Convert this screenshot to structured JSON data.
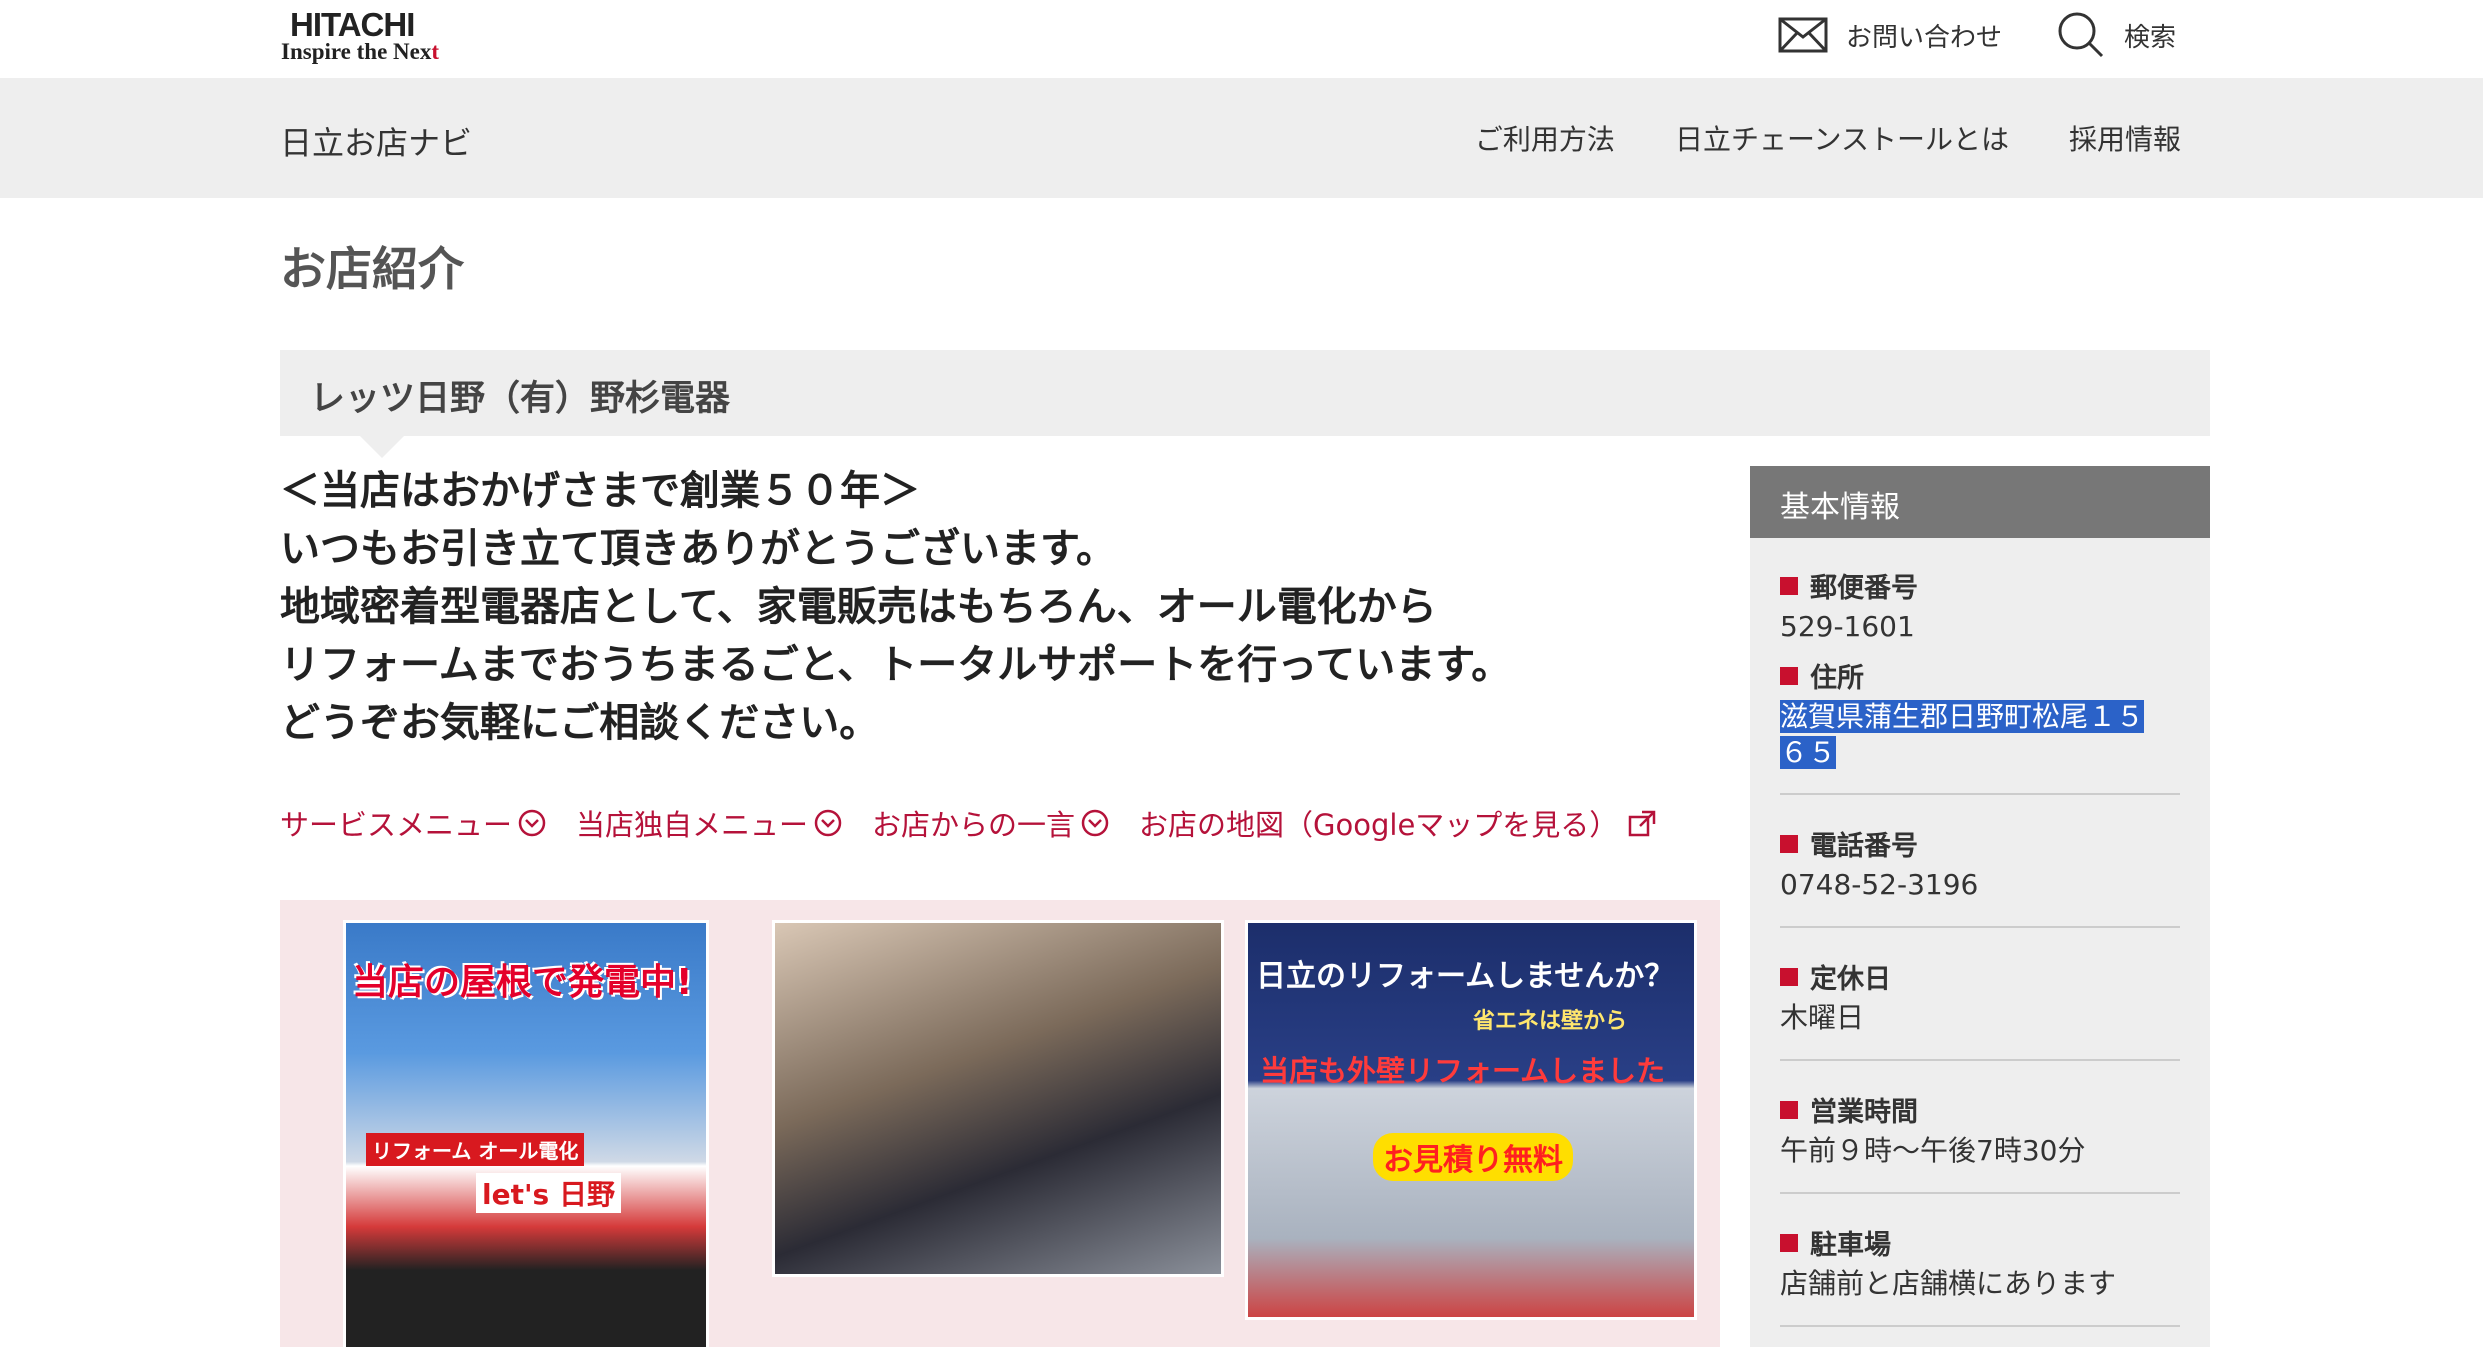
{
  "header": {
    "logo_text": "HITACHI",
    "tagline_main": "Inspire the Nex",
    "tagline_end": "t",
    "contact_label": "お問い合わせ",
    "search_label": "検索"
  },
  "nav": {
    "site_name": "日立お店ナビ",
    "links": [
      "ご利用方法",
      "日立チェーンストールとは",
      "採用情報"
    ]
  },
  "page": {
    "title": "お店紹介",
    "shop_name": "レッツ日野（有）野杉電器"
  },
  "intro": {
    "lines": [
      "＜当店はおかげさまで創業５０年＞",
      "いつもお引き立て頂きありがとうございます。",
      "地域密着型電器店として、家電販売はもちろん、オール電化から",
      "リフォームまでおうちまるごと、トータルサポートを行っています。",
      "どうぞお気軽にご相談ください。"
    ]
  },
  "anchors": [
    "サービスメニュー",
    "当店独自メニュー",
    "お店からの一言",
    "お店の地図（Googleマップを見る）"
  ],
  "photos": {
    "p1": [
      "当店の屋根で発電中!",
      "リフォーム オール電化",
      "let's 日野"
    ],
    "p3": [
      "日立のリフォームしませんか？",
      "省エネは壁から",
      "当店も外壁リフォームしました",
      "お見積り無料"
    ]
  },
  "sidebar": {
    "heading": "基本情報",
    "items": [
      {
        "label": "郵便番号",
        "value_lines": [
          "529-1601"
        ]
      },
      {
        "label": "住所",
        "value_lines": [
          "滋賀県蒲生郡日野町松尾１５",
          "６５"
        ]
      },
      {
        "label": "電話番号",
        "value_lines": [
          "0748-52-3196"
        ]
      },
      {
        "label": "定休日",
        "value_lines": [
          "木曜日"
        ]
      },
      {
        "label": "営業時間",
        "value_lines": [
          "午前９時～午後7時30分"
        ]
      },
      {
        "label": "駐車場",
        "value_lines": [
          "店舗前と店舗横にあります"
        ]
      }
    ]
  },
  "colors": {
    "accent_red": "#c8102e",
    "link_red": "#b5123a",
    "band_gray": "#eeeeee",
    "sidebar_head": "#777777",
    "selection_blue": "#2b62c8"
  }
}
